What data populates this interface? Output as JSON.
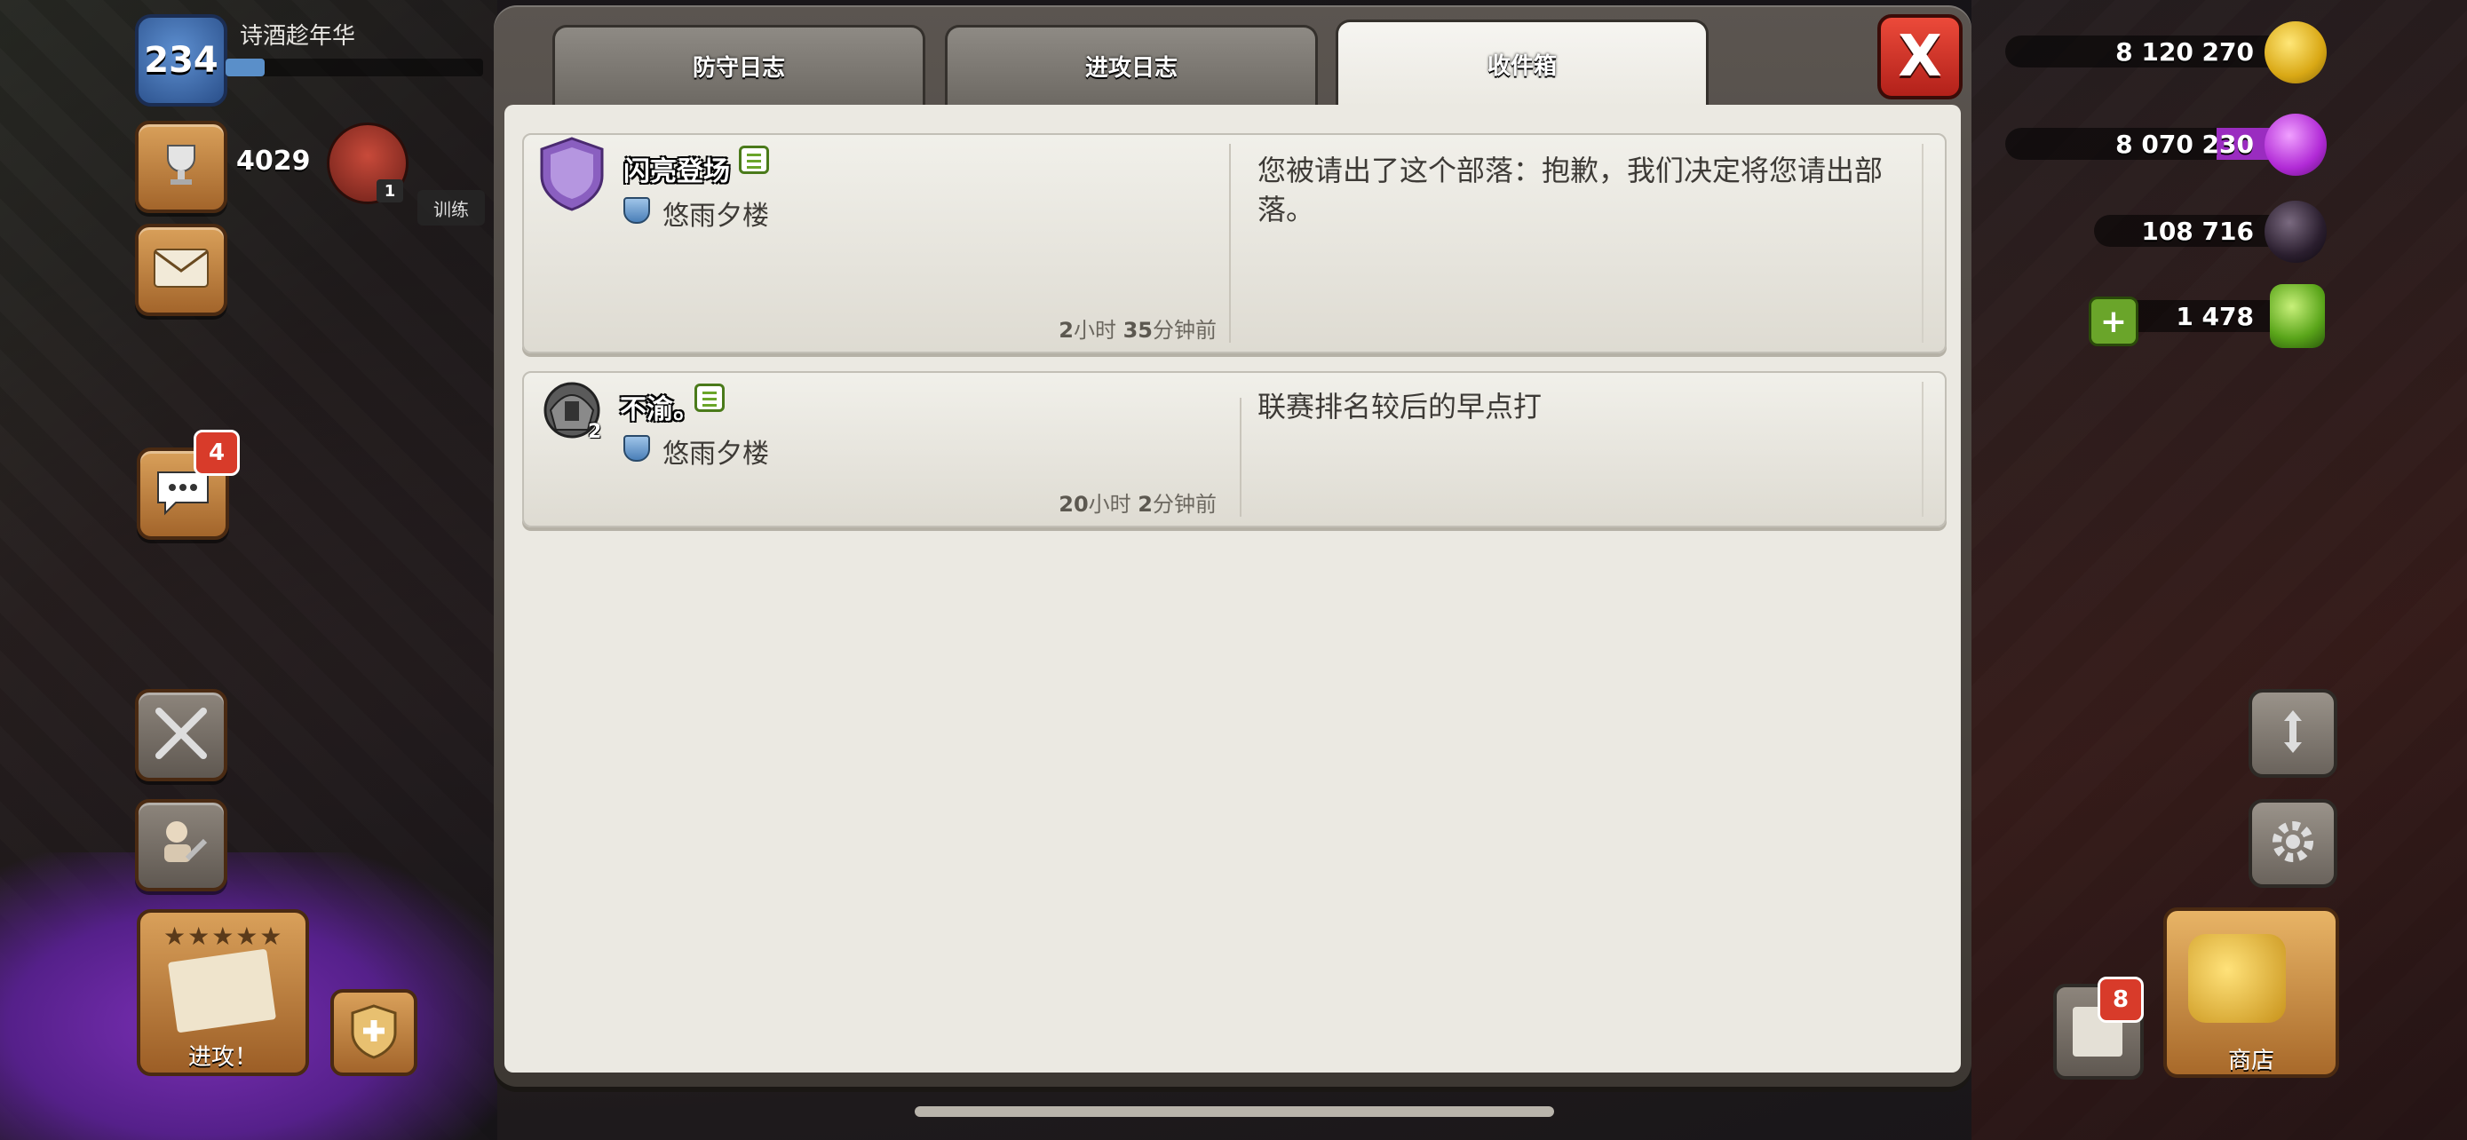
{
  "player": {
    "level": "234",
    "name": "诗酒趁年华",
    "xp_progress": 0.15
  },
  "hud_left": {
    "trophies": "4029",
    "league_rank": "1",
    "train_label": "训练",
    "chat_badge": "4",
    "attack_label": "进攻！",
    "attack_stars": "★★★★★"
  },
  "resources": {
    "gold": "8 120 270",
    "elixir": "8 070 230",
    "dark_elixir": "108 716",
    "gems": "1 478"
  },
  "hud_right": {
    "mail_badge": "8",
    "shop_label": "商店"
  },
  "modal": {
    "tabs": [
      {
        "label": "防守日志",
        "active": false
      },
      {
        "label": "进攻日志",
        "active": false
      },
      {
        "label": "收件箱",
        "active": true
      }
    ],
    "close_label": "X",
    "messages": [
      {
        "sender": "闪亮登场",
        "clan": "悠雨夕楼",
        "time_h": "2",
        "time_h_unit": "小时 ",
        "time_m": "35",
        "time_m_unit": "分钟前",
        "text": "您被请出了这个部落：抱歉，我们决定将您请出部落。"
      },
      {
        "sender": "不渝。",
        "clan": "悠雨夕楼",
        "badge_num": "2",
        "time_h": "20",
        "time_h_unit": "小时 ",
        "time_m": "2",
        "time_m_unit": "分钟前",
        "text": "联赛排名较后的早点打"
      }
    ]
  },
  "colors": {
    "accent_close": "#d83226",
    "panel_bg": "#ebe9e2",
    "tab_active": "#f6f5f1"
  }
}
